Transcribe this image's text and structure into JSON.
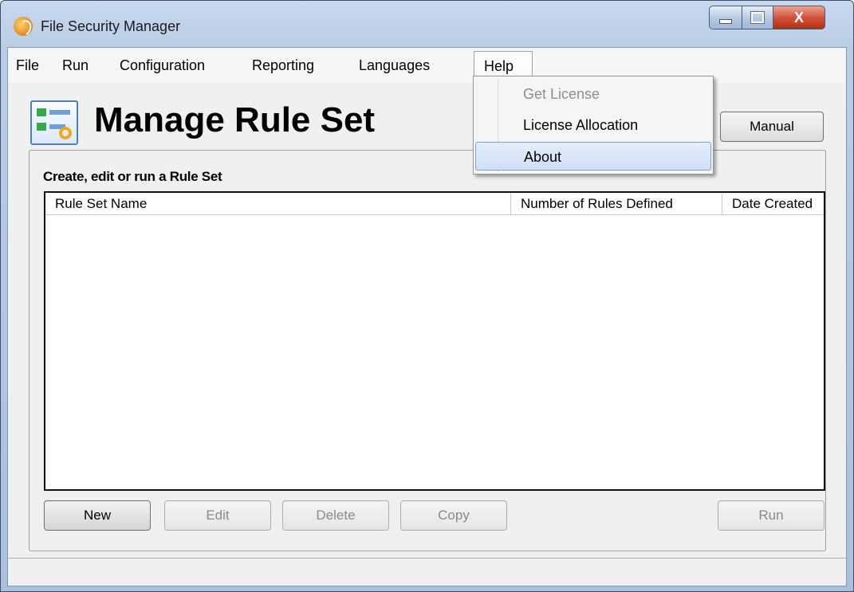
{
  "window": {
    "title": "File Security Manager",
    "icon": "app-logo-icon",
    "controls": {
      "minimize_icon": "minimize-icon",
      "maximize_icon": "maximize-icon",
      "close_glyph": "X"
    }
  },
  "menubar": {
    "items": [
      {
        "label": "File"
      },
      {
        "label": "Run"
      },
      {
        "label": "Configuration"
      },
      {
        "label": "Reporting"
      },
      {
        "label": "Languages"
      },
      {
        "label": "Help"
      }
    ],
    "open_menu": "Help"
  },
  "help_menu": {
    "items": [
      {
        "label": "Get License",
        "enabled": false
      },
      {
        "label": "License Allocation",
        "enabled": true
      },
      {
        "label": "About",
        "enabled": true,
        "highlighted": true
      }
    ]
  },
  "header": {
    "title": "Manage Rule Set",
    "icon": "rule-set-icon",
    "manual_label": "Manual"
  },
  "group": {
    "label": "Create, edit or run a Rule Set"
  },
  "table": {
    "columns": [
      "Rule Set Name",
      "Number of Rules Defined",
      "Date Created"
    ],
    "rows": []
  },
  "buttons": {
    "new": {
      "label": "New",
      "enabled": true
    },
    "edit": {
      "label": "Edit",
      "enabled": false
    },
    "delete": {
      "label": "Delete",
      "enabled": false
    },
    "copy": {
      "label": "Copy",
      "enabled": false
    },
    "run": {
      "label": "Run",
      "enabled": false
    }
  },
  "colors": {
    "titlebar": "#b9cde6",
    "close_button": "#d2533a",
    "highlight": "#cfe0f6",
    "disabled_text": "#8b8b8b"
  }
}
